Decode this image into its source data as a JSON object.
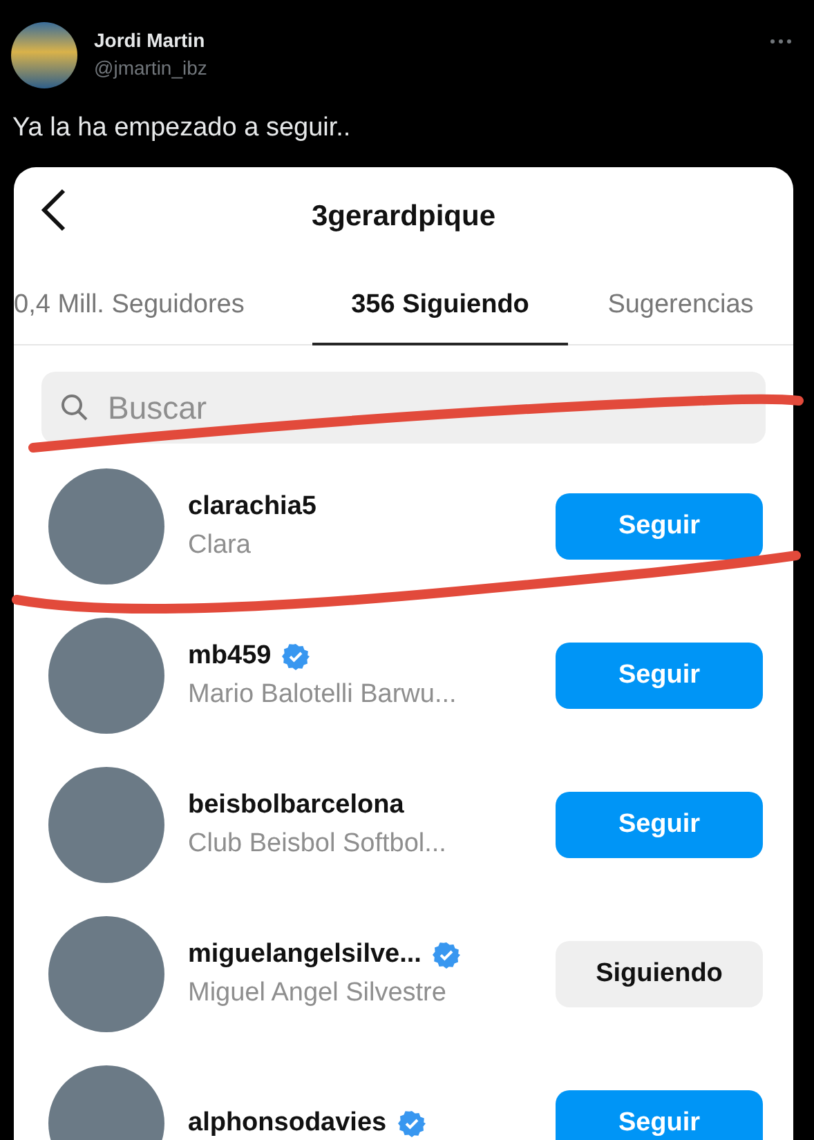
{
  "tweet": {
    "author": {
      "name": "Jordi Martin",
      "handle": "@jmartin_ibz"
    },
    "text": "Ya la ha empezado a seguir.."
  },
  "screenshot": {
    "title": "3gerardpique",
    "tabs": [
      {
        "label": "0,4 Mill. Seguidores",
        "selected": false
      },
      {
        "label": "356 Siguiendo",
        "selected": true
      },
      {
        "label": "Sugerencias",
        "selected": false
      }
    ],
    "search": {
      "placeholder": "Buscar"
    },
    "accounts": [
      {
        "username": "clarachia5",
        "name": "Clara",
        "verified": false,
        "following": false,
        "button": "Seguir"
      },
      {
        "username": "mb459",
        "name": "Mario Balotelli Barwu...",
        "verified": true,
        "following": false,
        "button": "Seguir"
      },
      {
        "username": "beisbolbarcelona",
        "name": "Club Beisbol Softbol...",
        "verified": false,
        "following": false,
        "button": "Seguir"
      },
      {
        "username": "miguelangelsilve...",
        "name": "Miguel Angel Silvestre",
        "verified": true,
        "following": true,
        "button": "Siguiendo"
      },
      {
        "username": "alphonsodavies",
        "verified": true,
        "following": false,
        "button": "Seguir"
      }
    ]
  }
}
